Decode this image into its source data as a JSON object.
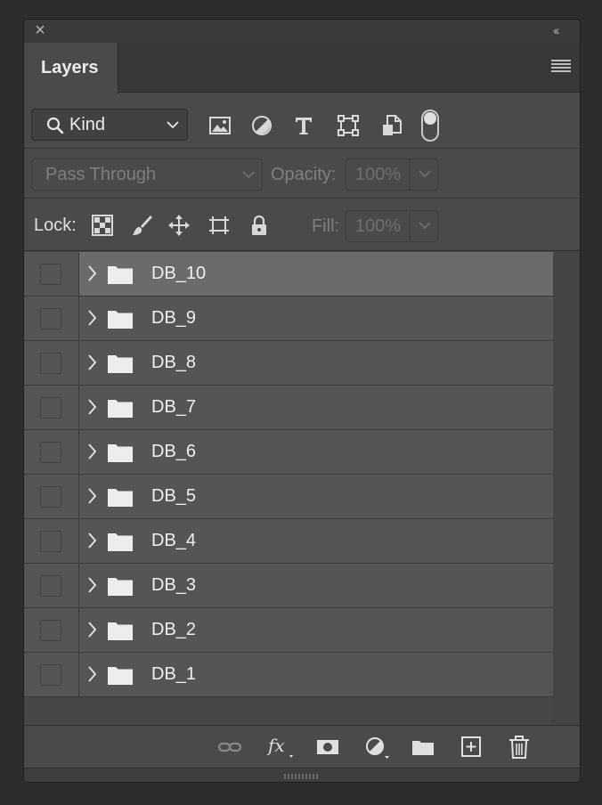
{
  "panel": {
    "tab_label": "Layers"
  },
  "filter": {
    "kind_label": "Kind",
    "icons": [
      "image-filter-icon",
      "adjustment-filter-icon",
      "type-filter-icon",
      "shape-filter-icon",
      "smart-object-filter-icon"
    ],
    "toggle_on": true
  },
  "blend": {
    "mode": "Pass Through",
    "opacity_label": "Opacity:",
    "opacity_value": "100%"
  },
  "lock": {
    "label": "Lock:",
    "icons": [
      "lock-transparent-pixels-icon",
      "lock-image-pixels-icon",
      "lock-position-icon",
      "lock-artboard-icon",
      "lock-all-icon"
    ],
    "fill_label": "Fill:",
    "fill_value": "100%"
  },
  "layers": [
    {
      "name": "DB_10",
      "selected": true
    },
    {
      "name": "DB_9",
      "selected": false
    },
    {
      "name": "DB_8",
      "selected": false
    },
    {
      "name": "DB_7",
      "selected": false
    },
    {
      "name": "DB_6",
      "selected": false
    },
    {
      "name": "DB_5",
      "selected": false
    },
    {
      "name": "DB_4",
      "selected": false
    },
    {
      "name": "DB_3",
      "selected": false
    },
    {
      "name": "DB_2",
      "selected": false
    },
    {
      "name": "DB_1",
      "selected": false
    }
  ],
  "bottom_icons": [
    "link-layers-icon",
    "fx-icon",
    "layer-mask-icon",
    "new-adjustment-layer-icon",
    "new-group-icon",
    "new-layer-icon",
    "delete-icon"
  ],
  "colors": {
    "background": "#2d2d2d",
    "panel": "#4a4a4a",
    "row": "#555555",
    "row_selected": "#6b6b6b",
    "text": "#f0f0f0"
  }
}
